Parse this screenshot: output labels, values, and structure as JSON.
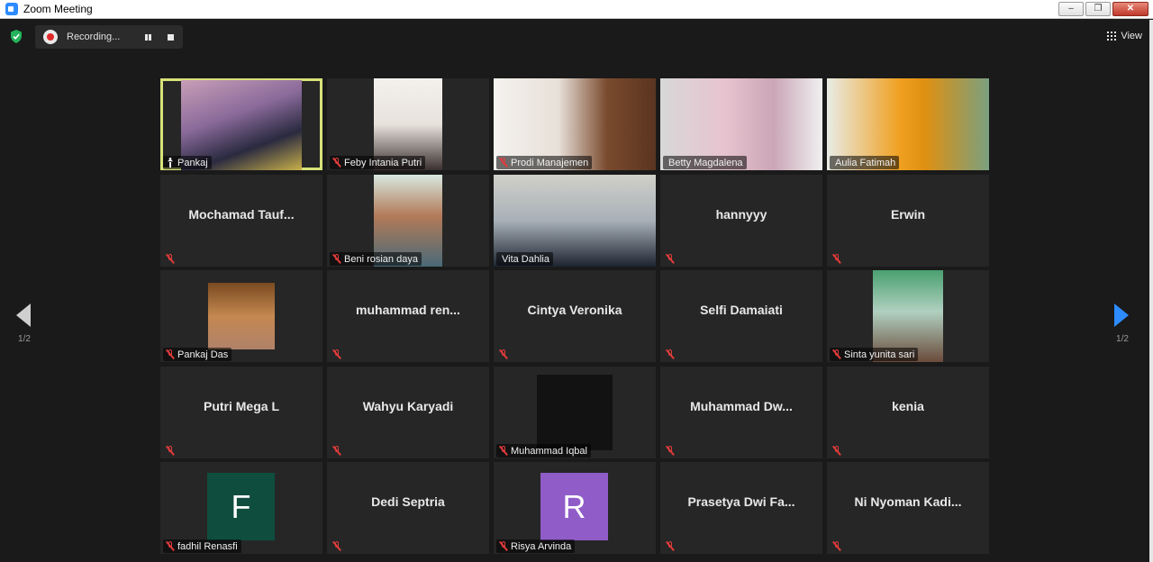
{
  "window": {
    "title": "Zoom Meeting"
  },
  "toolbar": {
    "recording_label": "Recording...",
    "view_label": "View"
  },
  "pagination": {
    "prev_page": "1/2",
    "next_page": "1/2"
  },
  "participants": [
    {
      "name": "Pankaj",
      "video": true,
      "active": true,
      "icon": "pin-icon"
    },
    {
      "name": "Feby Intania Putri",
      "video": true,
      "icon": "mic-off-icon"
    },
    {
      "name": "Prodi Manajemen",
      "video": true,
      "icon": "mic-off-icon"
    },
    {
      "name": "Betty Magdalena",
      "video": true,
      "icon": "none"
    },
    {
      "name": "Aulia Fatimah",
      "video": true,
      "icon": "none"
    },
    {
      "name": "Mochamad  Tauf...",
      "video": false,
      "icon": "mic-off-icon"
    },
    {
      "name": "Beni rosian daya",
      "video": true,
      "icon": "mic-off-icon"
    },
    {
      "name": "Vita Dahlia",
      "video": true,
      "icon": "none"
    },
    {
      "name": "hannyyy",
      "video": false,
      "icon": "mic-off-icon"
    },
    {
      "name": "Erwin",
      "video": false,
      "icon": "mic-off-icon"
    },
    {
      "name": "Pankaj Das",
      "video": true,
      "icon": "mic-off-icon"
    },
    {
      "name": "muhammad  ren...",
      "video": false,
      "icon": "mic-off-icon"
    },
    {
      "name": "Cintya Veronika",
      "video": false,
      "icon": "mic-off-icon"
    },
    {
      "name": "Selfi Damaiati",
      "video": false,
      "icon": "mic-off-icon"
    },
    {
      "name": "Sinta yunita sari",
      "video": true,
      "icon": "mic-off-icon"
    },
    {
      "name": "Putri Mega L",
      "video": false,
      "icon": "mic-off-icon"
    },
    {
      "name": "Wahyu Karyadi",
      "video": false,
      "icon": "mic-off-icon"
    },
    {
      "name": "Muhammad Iqbal",
      "video": true,
      "icon": "mic-off-icon"
    },
    {
      "name": "Muhammad  Dw...",
      "video": false,
      "icon": "mic-off-icon"
    },
    {
      "name": "kenia",
      "video": false,
      "icon": "mic-off-icon"
    },
    {
      "name": "fadhil Renasfi",
      "video": false,
      "avatar_letter": "F",
      "avatar_color": "#0f4d3e",
      "icon": "mic-off-icon"
    },
    {
      "name": "Dedi Septria",
      "video": false,
      "icon": "mic-off-icon"
    },
    {
      "name": "Risya Arvinda",
      "video": false,
      "avatar_letter": "R",
      "avatar_color": "#8f5cc8",
      "icon": "mic-off-icon"
    },
    {
      "name": "Prasetya  Dwi  Fa...",
      "video": false,
      "icon": "mic-off-icon"
    },
    {
      "name": "Ni  Nyoman  Kadi...",
      "video": false,
      "icon": "mic-off-icon"
    }
  ],
  "colors": {
    "active_border": "#d8e27a",
    "accent": "#2d8cff",
    "mic_off": "#e03b3b",
    "tile_bg": "#262626"
  }
}
